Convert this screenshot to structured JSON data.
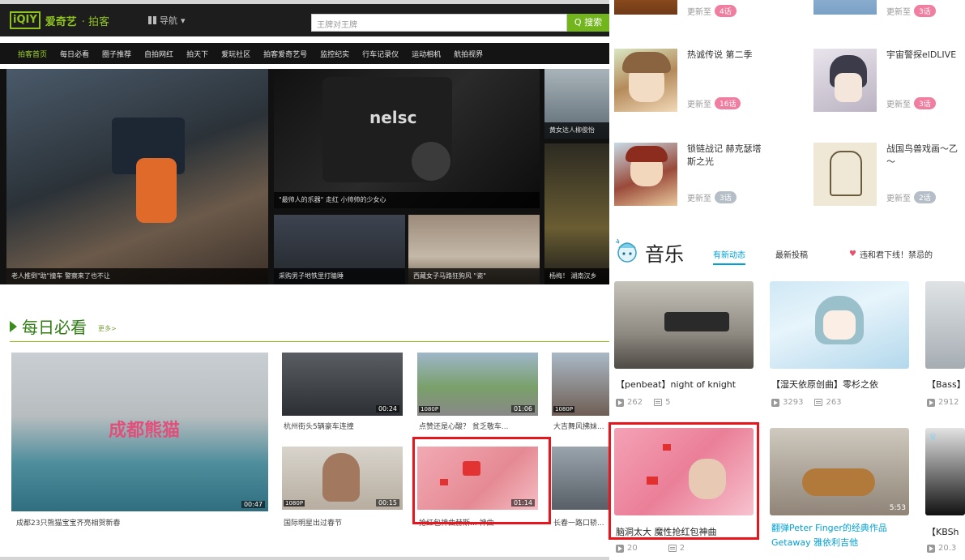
{
  "iqiyi": {
    "logo_box": "iQIY",
    "logo_text": "爱奇艺",
    "logo_sub": "· 拍客",
    "nav_label": "导航",
    "search_placeholder": "王牌对王牌",
    "search_button": "Q 搜索",
    "subnav": [
      "拍客首页",
      "每日必看",
      "圈子推荐",
      "自拍网红",
      "拍天下",
      "爱玩社区",
      "拍客爱奇艺号",
      "监控纪实",
      "行车记录仪",
      "运动相机",
      "航拍视界"
    ],
    "hero_captions": [
      "老人推倒\"助\"撞车 警察来了也不让",
      "\"最帅人的乐器\" 走红 小帅帅的少女心",
      "采购男子地铁里打瞌睡",
      "西藏女子马路狂狗风 \"瓷\"",
      "杨梅！ 湖南汉乡",
      "黄女达人柳俊怡"
    ],
    "section_title": "每日必看",
    "section_more": "更多>",
    "videos": [
      {
        "caption": "成都23只熊猫宝宝齐亮相贺新春",
        "duration": "00:47",
        "hd": ""
      },
      {
        "caption": "杭州街头5辆豪车连撞",
        "duration": "00:24",
        "hd": ""
      },
      {
        "caption": "点赞还是心酸？ 贫乏敬车...",
        "duration": "01:06",
        "hd": "1080P"
      },
      {
        "caption": "大吉舞风拂妹...",
        "duration": "",
        "hd": "1080P"
      },
      {
        "caption": "国际明星出过春节",
        "duration": "00:15",
        "hd": "1080P"
      },
      {
        "caption": "抢红包神曲赫斯... 神曲",
        "duration": "01:14",
        "hd": ""
      },
      {
        "caption": "长春一路口轿...",
        "duration": "",
        "hd": ""
      }
    ]
  },
  "bilibili": {
    "update_prefix": "更新至",
    "anime": [
      {
        "title": "",
        "episodes": "4话",
        "color": "pink"
      },
      {
        "title": "",
        "episodes": "3话",
        "color": "pink"
      },
      {
        "title": "热诚传说 第二季",
        "episodes": "16话",
        "color": "pink"
      },
      {
        "title": "宇宙警探elDLIVE",
        "episodes": "3话",
        "color": "pink"
      },
      {
        "title": "锁链战记 赫克瑟塔斯之光",
        "episodes": "3话",
        "color": "gray"
      },
      {
        "title": "战国鸟兽戏画～乙～",
        "episodes": "2话",
        "color": "gray"
      }
    ],
    "music": {
      "title": "音乐",
      "tabs": [
        "有新动态",
        "最新投稿"
      ],
      "notice": "违和君下线！禁忌的",
      "items": [
        {
          "title": "【penbeat】night of knight",
          "plays": "262",
          "danmaku": "5"
        },
        {
          "title": "【湿天依原创曲】零杉之依",
          "plays": "3293",
          "danmaku": "263"
        },
        {
          "title": "【Bass】",
          "plays": "2912",
          "danmaku": ""
        },
        {
          "title": "脑洞太大 魔性抢红包神曲",
          "plays": "20",
          "danmaku": "2"
        },
        {
          "title": "翻弹Peter Finger的经典作品Getaway 雅依利吉他",
          "plays": "",
          "danmaku": ""
        },
        {
          "title": "【KBSh",
          "plays": "20.3",
          "danmaku": ""
        }
      ]
    }
  },
  "colors": {
    "iqiyi_green": "#8ec31f",
    "bili_blue": "#00a1d6",
    "bili_pink": "#f07ea0",
    "highlight_red": "#e8161c"
  }
}
